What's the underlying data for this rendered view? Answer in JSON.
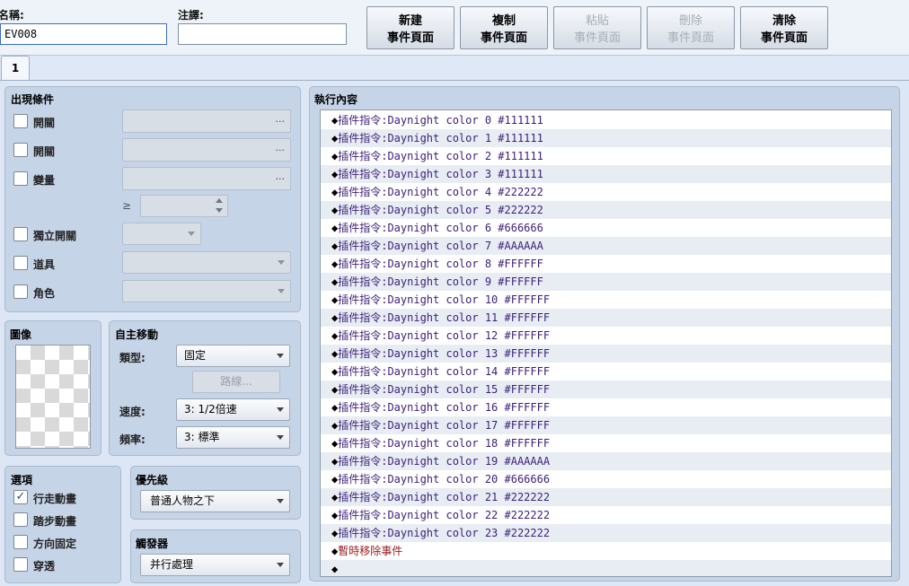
{
  "header": {
    "name_label": "名稱:",
    "name_value": "EV008",
    "note_label": "注譯:",
    "note_value": "",
    "buttons": [
      {
        "line1": "新建",
        "line2": "事件頁面",
        "enabled": true
      },
      {
        "line1": "複制",
        "line2": "事件頁面",
        "enabled": true
      },
      {
        "line1": "粘貼",
        "line2": "事件頁面",
        "enabled": false
      },
      {
        "line1": "刪除",
        "line2": "事件頁面",
        "enabled": false
      },
      {
        "line1": "清除",
        "line2": "事件頁面",
        "enabled": true
      }
    ],
    "page_tab": "1"
  },
  "conditions": {
    "title": "出現條件",
    "switch1_label": "開關",
    "switch2_label": "開關",
    "variable_label": "變量",
    "ge_symbol": "≥",
    "self_switch_label": "獨立開關",
    "item_label": "道具",
    "actor_label": "角色",
    "ellipsis": "..."
  },
  "image": {
    "title": "圖像"
  },
  "autonomous": {
    "title": "自主移動",
    "type_label": "類型:",
    "type_value": "固定",
    "route_button": "路線...",
    "speed_label": "速度:",
    "speed_value": "3: 1/2倍速",
    "freq_label": "頻率:",
    "freq_value": "3: 標準"
  },
  "options": {
    "title": "選項",
    "walking_label": "行走動畫",
    "walking_checked": true,
    "stepping_label": "踏步動畫",
    "stepping_checked": false,
    "direction_fix_label": "方向固定",
    "direction_fix_checked": false,
    "through_label": "穿透",
    "through_checked": false
  },
  "priority": {
    "title": "優先級",
    "value": "普通人物之下"
  },
  "trigger": {
    "title": "觸發器",
    "value": "并行處理"
  },
  "contents": {
    "title": "執行內容",
    "commands": [
      {
        "prefix": "◆",
        "text": "插件指令:Daynight color 0 #111111"
      },
      {
        "prefix": "◆",
        "text": "插件指令:Daynight color 1 #111111"
      },
      {
        "prefix": "◆",
        "text": "插件指令:Daynight color 2 #111111"
      },
      {
        "prefix": "◆",
        "text": "插件指令:Daynight color 3 #111111"
      },
      {
        "prefix": "◆",
        "text": "插件指令:Daynight color 4 #222222"
      },
      {
        "prefix": "◆",
        "text": "插件指令:Daynight color 5 #222222"
      },
      {
        "prefix": "◆",
        "text": "插件指令:Daynight color 6 #666666"
      },
      {
        "prefix": "◆",
        "text": "插件指令:Daynight color 7 #AAAAAA"
      },
      {
        "prefix": "◆",
        "text": "插件指令:Daynight color 8 #FFFFFF"
      },
      {
        "prefix": "◆",
        "text": "插件指令:Daynight color 9 #FFFFFF"
      },
      {
        "prefix": "◆",
        "text": "插件指令:Daynight color 10 #FFFFFF"
      },
      {
        "prefix": "◆",
        "text": "插件指令:Daynight color 11 #FFFFFF"
      },
      {
        "prefix": "◆",
        "text": "插件指令:Daynight color 12 #FFFFFF"
      },
      {
        "prefix": "◆",
        "text": "插件指令:Daynight color 13 #FFFFFF"
      },
      {
        "prefix": "◆",
        "text": "插件指令:Daynight color 14 #FFFFFF"
      },
      {
        "prefix": "◆",
        "text": "插件指令:Daynight color 15 #FFFFFF"
      },
      {
        "prefix": "◆",
        "text": "插件指令:Daynight color 16 #FFFFFF"
      },
      {
        "prefix": "◆",
        "text": "插件指令:Daynight color 17 #FFFFFF"
      },
      {
        "prefix": "◆",
        "text": "插件指令:Daynight color 18 #FFFFFF"
      },
      {
        "prefix": "◆",
        "text": "插件指令:Daynight color 19 #AAAAAA"
      },
      {
        "prefix": "◆",
        "text": "插件指令:Daynight color 20 #666666"
      },
      {
        "prefix": "◆",
        "text": "插件指令:Daynight color 21 #222222"
      },
      {
        "prefix": "◆",
        "text": "插件指令:Daynight color 22 #222222"
      },
      {
        "prefix": "◆",
        "text": "插件指令:Daynight color 23 #222222"
      },
      {
        "prefix": "◆",
        "text": "暫時移除事件",
        "style": "red"
      },
      {
        "prefix": "◆",
        "text": ""
      }
    ]
  },
  "colors": {
    "background": "#dfe8f6",
    "panel": "#c6d4e8",
    "command_text": "#3b1e7a",
    "erase_text": "#9a1a1a"
  }
}
